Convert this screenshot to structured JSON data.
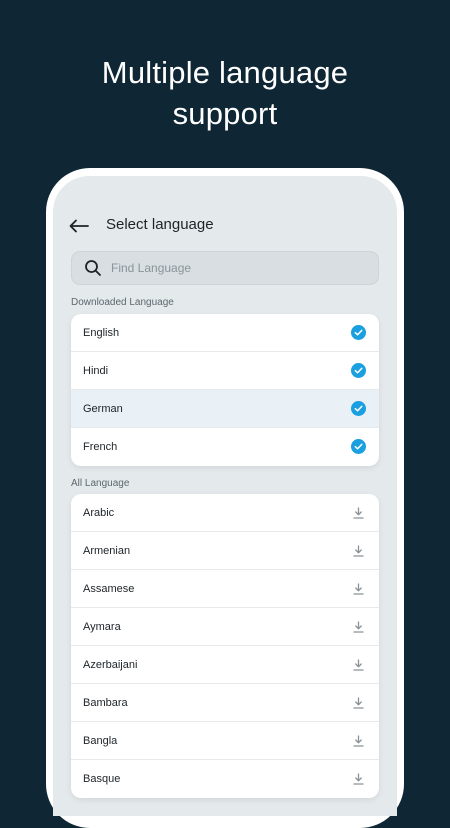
{
  "headline": {
    "line1": "Multiple language",
    "line2": "support"
  },
  "header": {
    "title": "Select language"
  },
  "search": {
    "placeholder": "Find Language"
  },
  "downloaded": {
    "label": "Downloaded Language",
    "items": [
      {
        "label": "English",
        "icon": "check-circle-icon",
        "selected": false
      },
      {
        "label": "Hindi",
        "icon": "check-circle-icon",
        "selected": false
      },
      {
        "label": "German",
        "icon": "check-circle-icon",
        "selected": true
      },
      {
        "label": "French",
        "icon": "check-circle-icon",
        "selected": false
      }
    ]
  },
  "all": {
    "label": "All Language",
    "items": [
      {
        "label": "Arabic",
        "icon": "download-icon"
      },
      {
        "label": "Armenian",
        "icon": "download-icon"
      },
      {
        "label": "Assamese",
        "icon": "download-icon"
      },
      {
        "label": "Aymara",
        "icon": "download-icon"
      },
      {
        "label": "Azerbaijani",
        "icon": "download-icon"
      },
      {
        "label": "Bambara",
        "icon": "download-icon"
      },
      {
        "label": "Bangla",
        "icon": "download-icon"
      },
      {
        "label": "Basque",
        "icon": "download-icon"
      }
    ]
  },
  "colors": {
    "background": "#0f2735",
    "screen": "#e4e9ec",
    "accent": "#1a9fe0",
    "selected_row": "#e9f1f7"
  }
}
